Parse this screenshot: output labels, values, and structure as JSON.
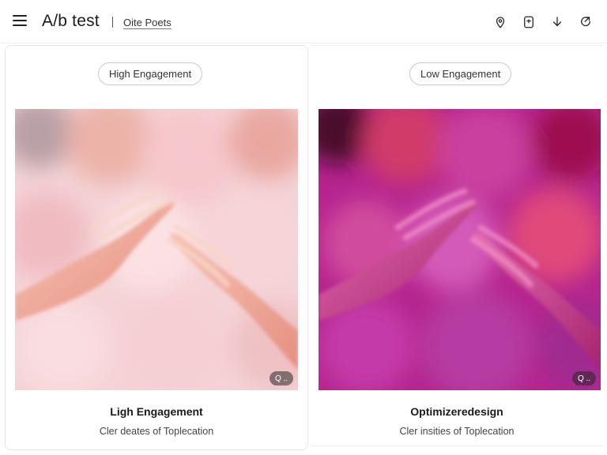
{
  "header": {
    "title": "A/b test",
    "subtitle_link": "Oite Poets",
    "icons": [
      "menu-icon",
      "pin-icon",
      "device-icon",
      "download-icon",
      "share-icon"
    ]
  },
  "variants": [
    {
      "pill_label": "High Engagement",
      "card_title": "Ligh Engagement",
      "card_desc": "Cler deates of Toplecation",
      "badge": "Q ..",
      "palette": [
        "#f3d6d8",
        "#f0b8bf",
        "#e8a18c"
      ]
    },
    {
      "pill_label": "Low Engagement",
      "card_title": "Optimizeredesign",
      "card_desc": "Cler insities of Toplecation",
      "badge": "Q ..",
      "palette": [
        "#c83d9f",
        "#b8218a",
        "#e0367a"
      ]
    }
  ]
}
